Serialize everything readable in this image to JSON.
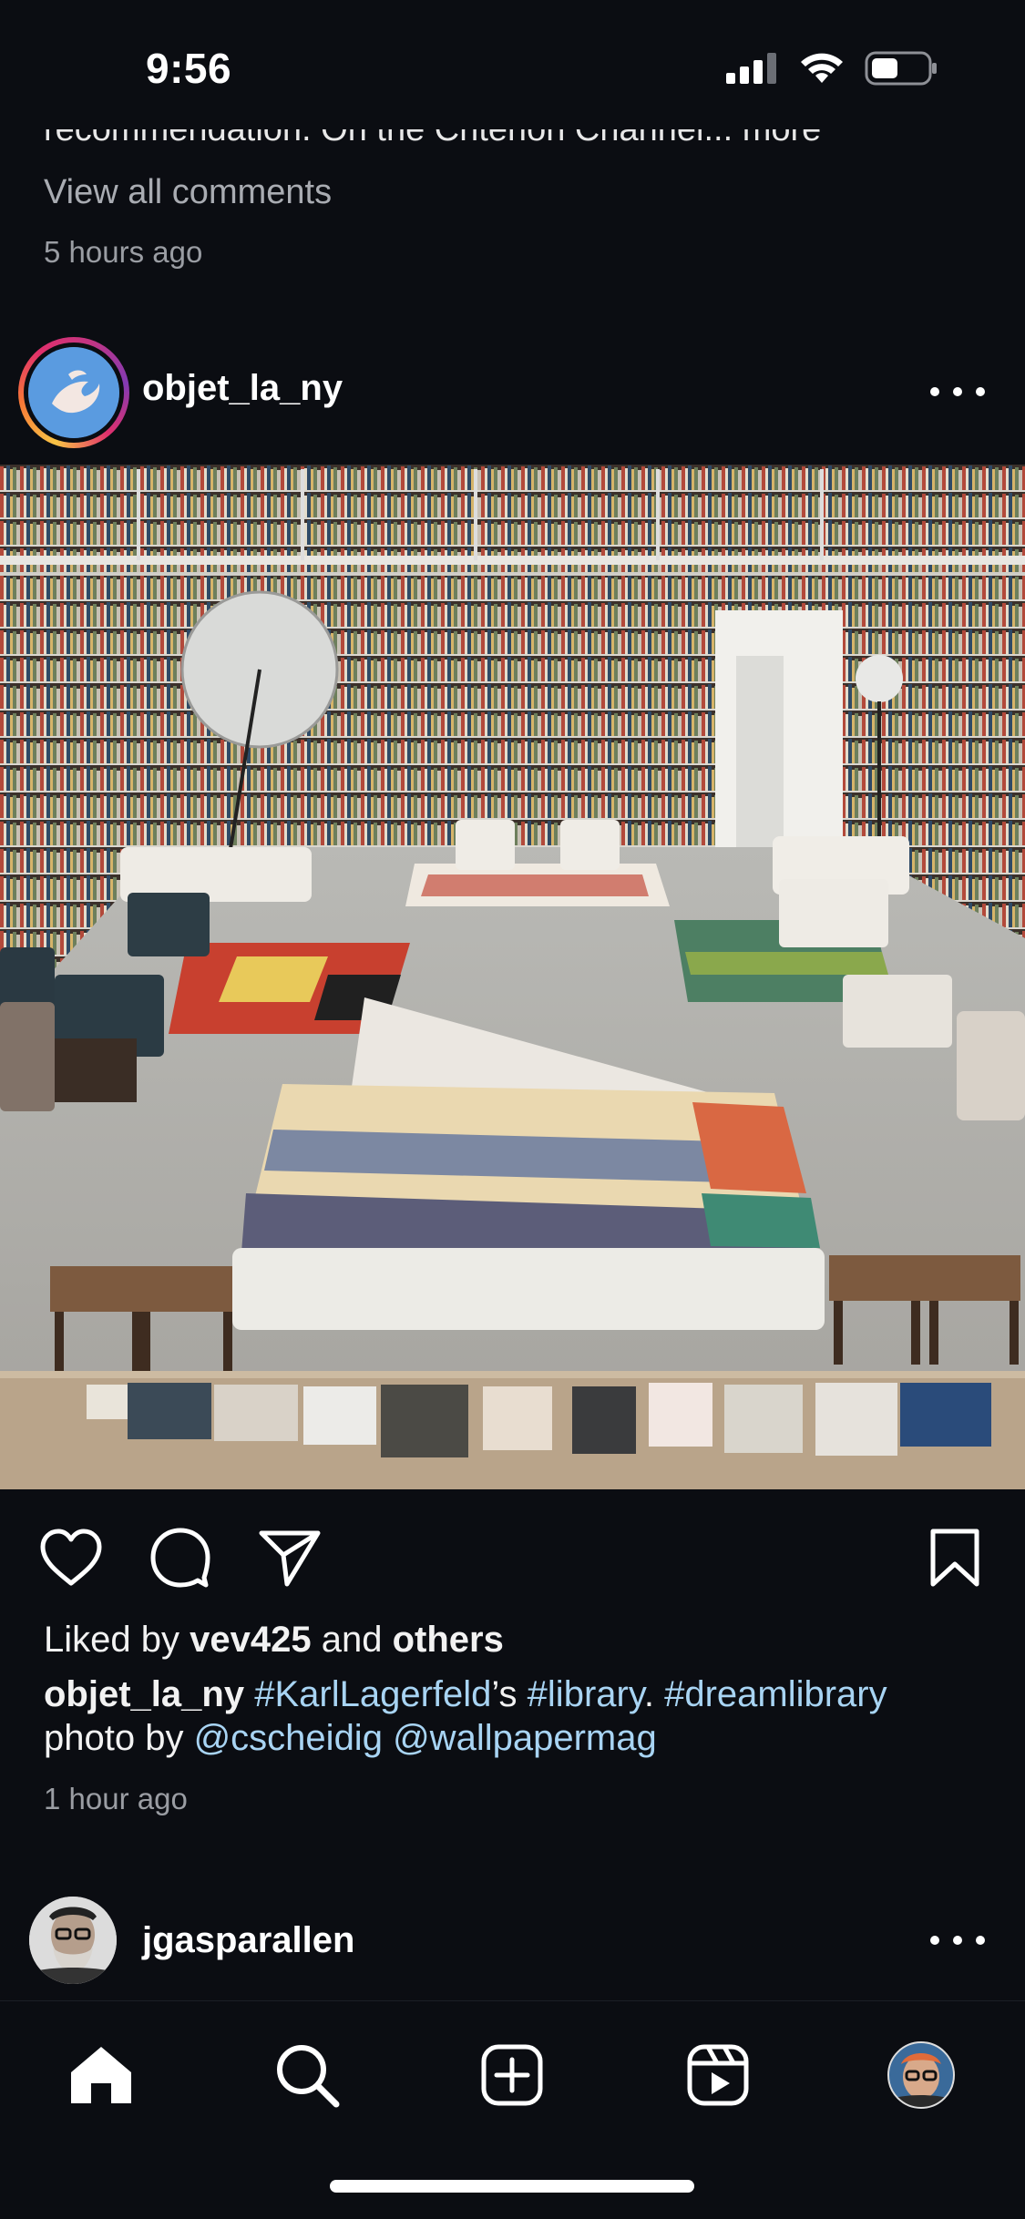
{
  "status_bar": {
    "time": "9:56"
  },
  "previous_post": {
    "caption_cut": "recommendation. On the Criterion Channel... more",
    "view_comments": "View all comments",
    "time_ago": "5 hours ago"
  },
  "post": {
    "username": "objet_la_ny",
    "liked_by_prefix": "Liked by ",
    "liked_by_user": "vev425",
    "liked_by_and": " and ",
    "liked_by_others": "others",
    "caption_user": "objet_la_ny",
    "caption_tag1": "#KarlLagerfeld",
    "caption_mid": "’s ",
    "caption_tag2": "#library",
    "caption_dot": ". ",
    "caption_tag3": "#dreamlibrary",
    "caption_line2": "photo by ",
    "caption_mention1": "@cscheidig",
    "caption_mention2": "@wallpapermag",
    "time_ago": "1 hour ago",
    "image_icon": "library-photo"
  },
  "next_post": {
    "username": "jgasparallen"
  },
  "tab_bar": {
    "items": [
      "home-icon",
      "search-icon",
      "create-icon",
      "reels-icon",
      "profile-avatar"
    ]
  },
  "colors": {
    "background": "#0b0d12",
    "hashtag": "#a8d4f3",
    "story_ring": [
      "#f9c445",
      "#f77737",
      "#e1306c",
      "#c13584",
      "#833ab4"
    ]
  }
}
